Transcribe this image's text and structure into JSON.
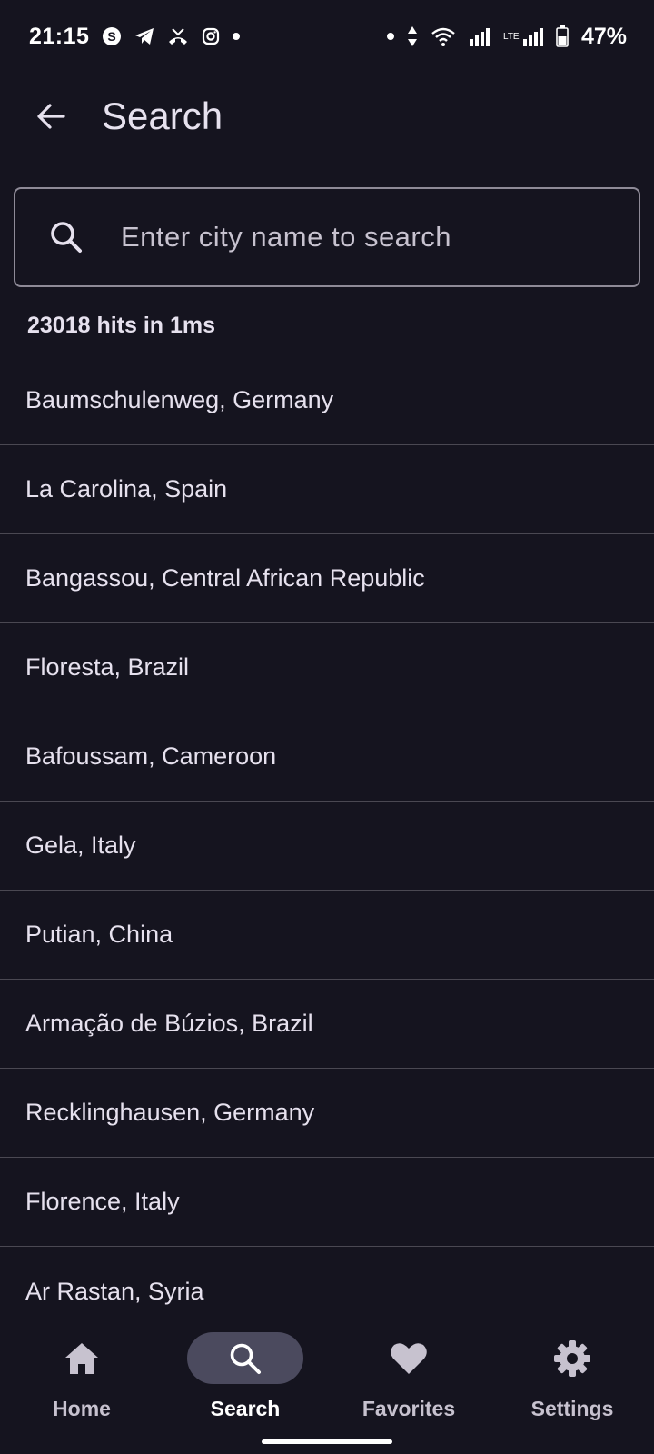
{
  "status_bar": {
    "time": "21:15",
    "battery": "47%",
    "icons_left": [
      "skype-icon",
      "telegram-icon",
      "missed-call-icon",
      "instagram-icon",
      "dot-icon"
    ],
    "icons_right": [
      "dot-icon",
      "data-arrows-icon",
      "wifi-icon",
      "signal-icon",
      "lte-signal-icon",
      "battery-icon"
    ]
  },
  "app_bar": {
    "title": "Search",
    "back_icon": "arrow-back-icon"
  },
  "search": {
    "placeholder": "Enter city name to search",
    "value": "",
    "icon": "search-icon"
  },
  "hits_text": "23018 hits in 1ms",
  "results": [
    "Baumschulenweg, Germany",
    "La Carolina, Spain",
    "Bangassou, Central African Republic",
    "Floresta, Brazil",
    "Bafoussam, Cameroon",
    "Gela, Italy",
    "Putian, China",
    "Armação de Búzios, Brazil",
    "Recklinghausen, Germany",
    "Florence, Italy",
    "Ar Rastan, Syria"
  ],
  "bottom_nav": [
    {
      "label": "Home",
      "icon": "home-icon",
      "active": false
    },
    {
      "label": "Search",
      "icon": "search-icon",
      "active": true
    },
    {
      "label": "Favorites",
      "icon": "heart-icon",
      "active": false
    },
    {
      "label": "Settings",
      "icon": "gear-icon",
      "active": false
    }
  ],
  "colors": {
    "background": "#15141f",
    "text": "#e6e1ee",
    "active_pill": "#4b4a5e",
    "divider": "#4a4852"
  }
}
